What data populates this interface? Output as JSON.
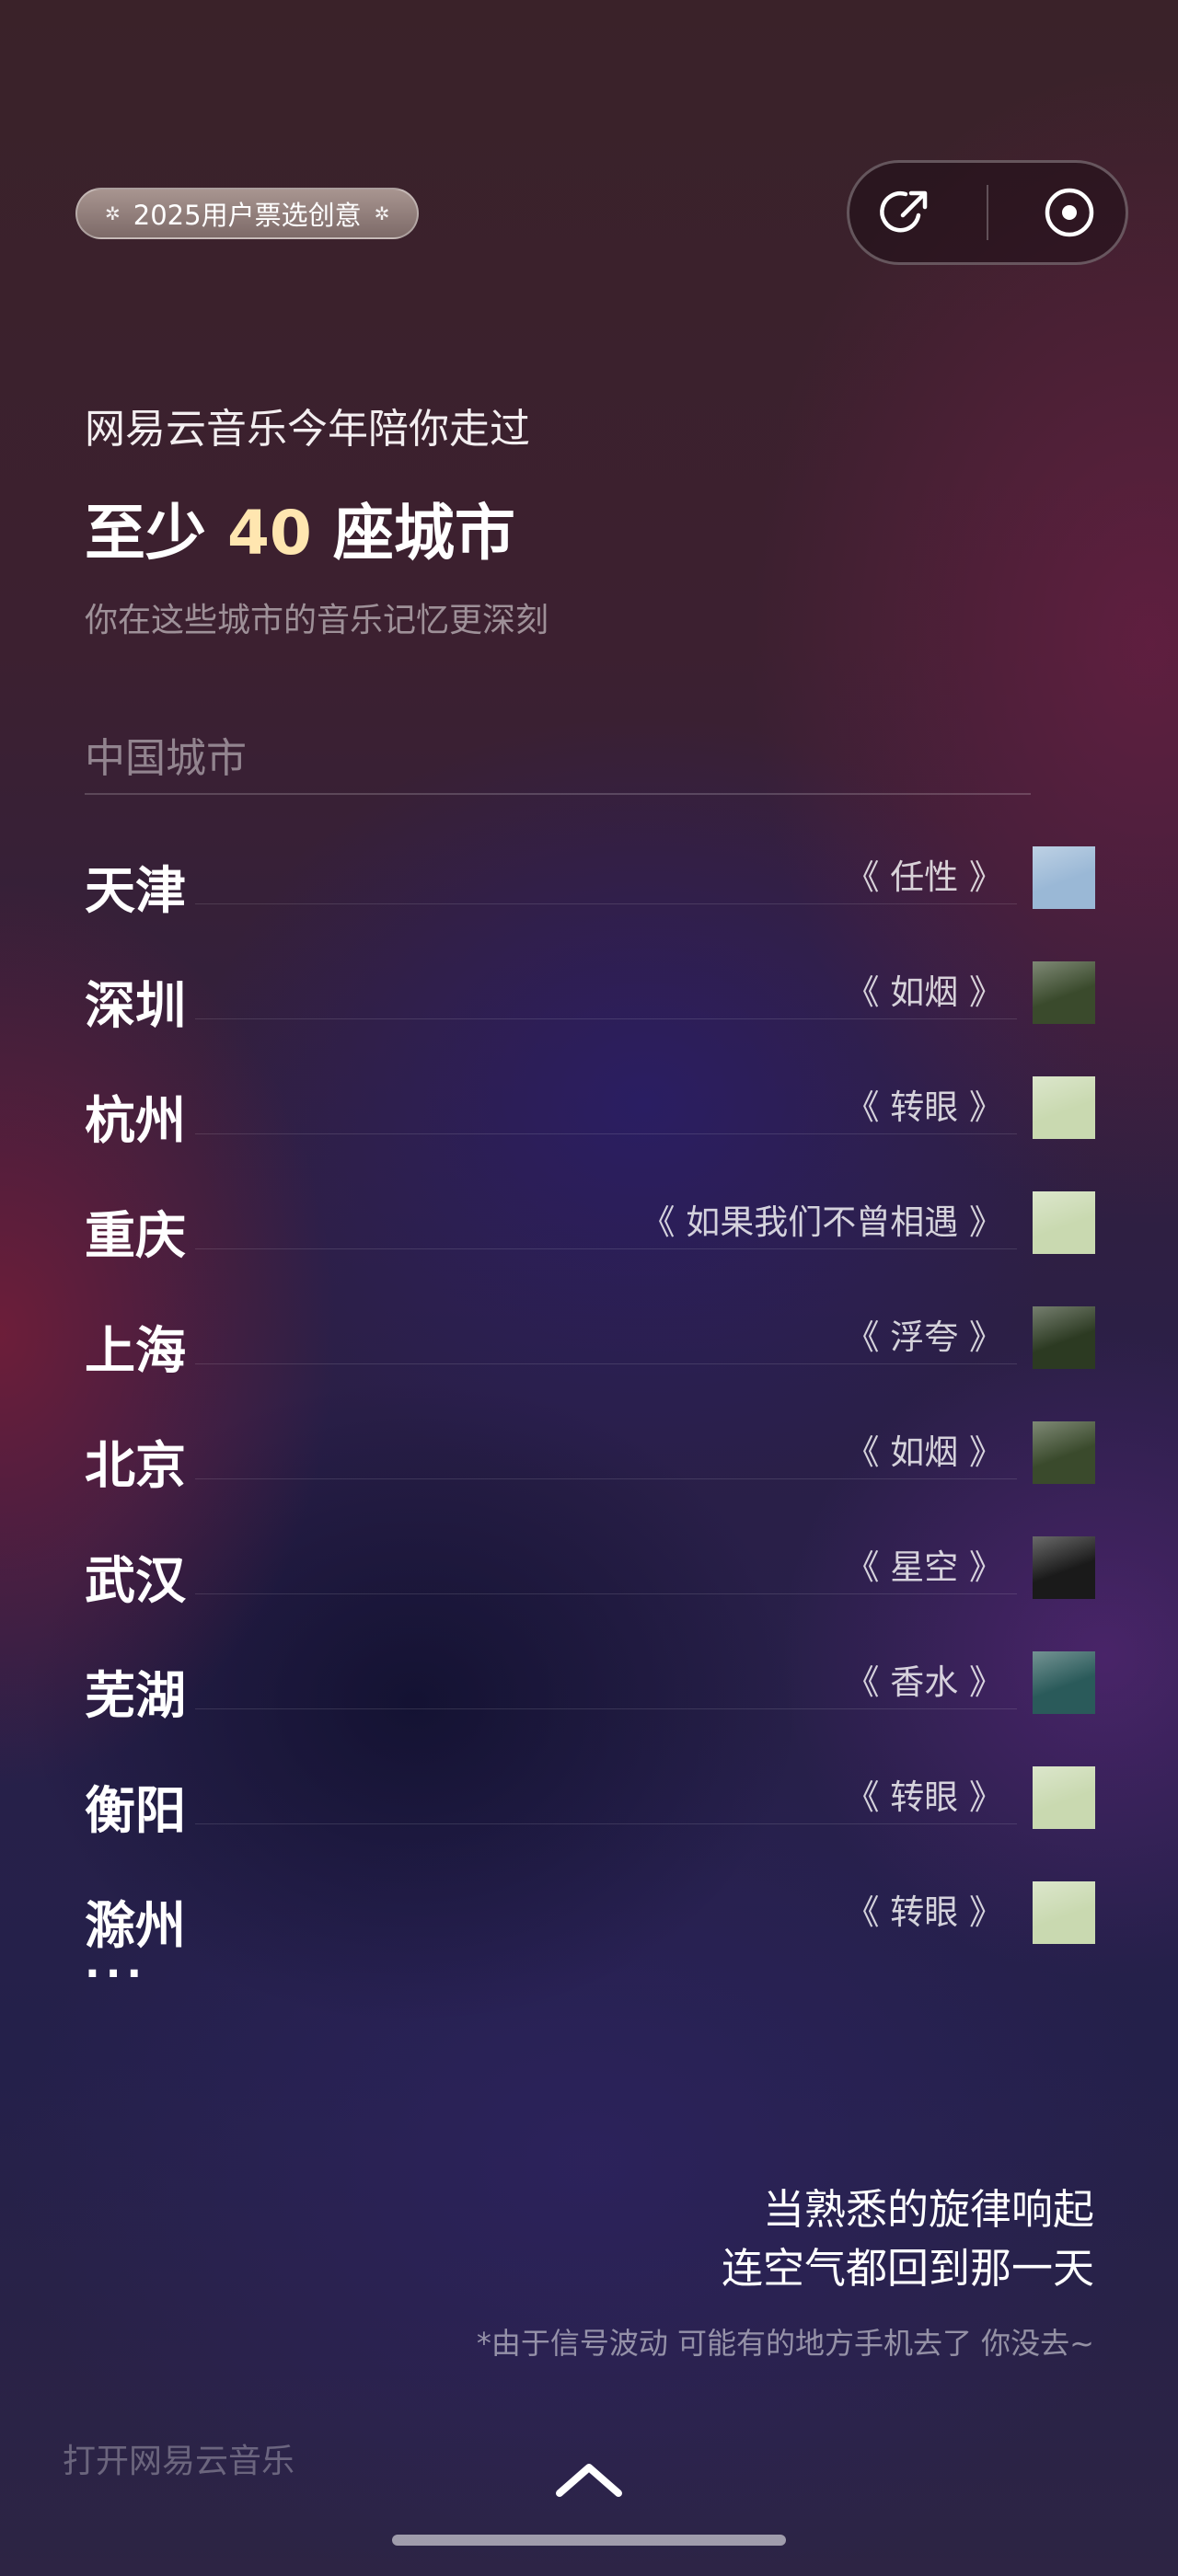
{
  "badge": {
    "label": "2025用户票选创意"
  },
  "top_buttons": {
    "share_icon": "share-arrow-icon",
    "record_icon": "record-dot-icon"
  },
  "intro": {
    "line": "网易云音乐今年陪你走过"
  },
  "headline": {
    "prefix": "至少 ",
    "count": "40",
    "suffix": " 座城市"
  },
  "subtitle": "你在这些城市的音乐记忆更深刻",
  "section_title": "中国城市",
  "cities": [
    {
      "city": "天津",
      "song": "《 任性 》",
      "cover_color": "#9ab8d6"
    },
    {
      "city": "深圳",
      "song": "《 如烟 》",
      "cover_color": "#3a4a2c"
    },
    {
      "city": "杭州",
      "song": "《 转眼 》",
      "cover_color": "#c9d9b0"
    },
    {
      "city": "重庆",
      "song": "《 如果我们不曾相遇 》",
      "cover_color": "#c9d9b0"
    },
    {
      "city": "上海",
      "song": "《 浮夸 》",
      "cover_color": "#2c3a22"
    },
    {
      "city": "北京",
      "song": "《 如烟 》",
      "cover_color": "#3a4a2c"
    },
    {
      "city": "武汉",
      "song": "《 星空 》",
      "cover_color": "#1a1a1a"
    },
    {
      "city": "芜湖",
      "song": "《 香水 》",
      "cover_color": "#2a5a5a"
    },
    {
      "city": "衡阳",
      "song": "《 转眼 》",
      "cover_color": "#c9d9b0"
    },
    {
      "city": "滁州",
      "song": "《 转眼 》",
      "cover_color": "#c9d9b0"
    }
  ],
  "ellipsis": "···",
  "closing": {
    "line1": "当熟悉的旋律响起",
    "line2": "连空气都回到那一天"
  },
  "footnote": "*由于信号波动 可能有的地方手机去了 你没去~",
  "open_app": "打开网易云音乐"
}
